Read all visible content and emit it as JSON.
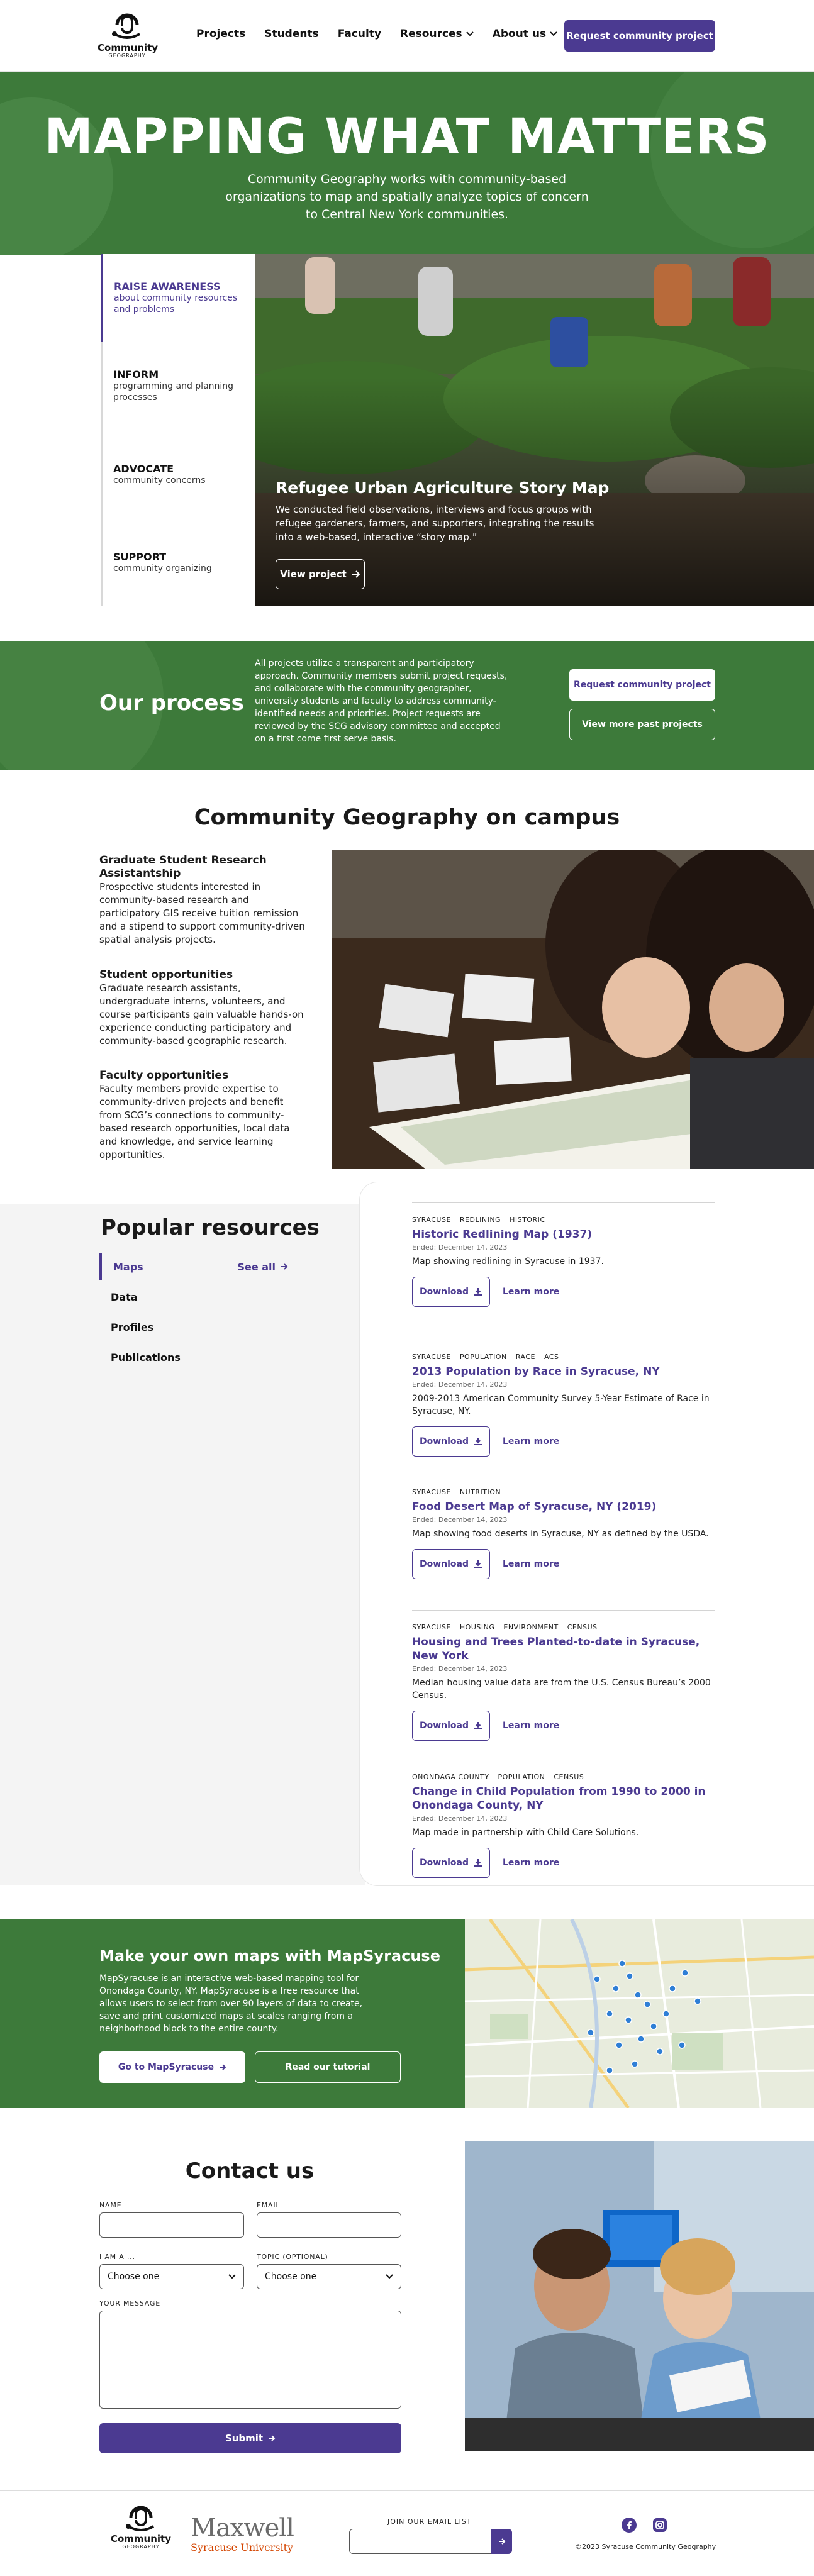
{
  "header": {
    "logo_line1": "Community",
    "logo_line2": "GEOGRAPHY",
    "nav": [
      "Projects",
      "Students",
      "Faculty",
      "Resources",
      "About us"
    ],
    "cta": "Request community project"
  },
  "hero": {
    "title": "MAPPING WHAT MATTERS",
    "subtitle": "Community Geography works with community-based organizations to map and spatially analyze topics of concern to Central New York communities."
  },
  "tabs": [
    {
      "title": "RAISE AWARENESS",
      "sub": "about community resources and problems"
    },
    {
      "title": "INFORM",
      "sub": "programming and planning processes"
    },
    {
      "title": "ADVOCATE",
      "sub": "community concerns"
    },
    {
      "title": "SUPPORT",
      "sub": "community organizing"
    }
  ],
  "feature": {
    "title": "Refugee Urban Agriculture Story Map",
    "desc": "We conducted field observations, interviews and focus groups with refugee gardeners, farmers, and supporters, integrating the results into a web-based, interactive “story map.”",
    "button": "View project"
  },
  "process": {
    "title": "Our process",
    "desc": "All projects utilize a transparent and participatory approach. Community members submit project requests, and collaborate with the community geographer, university students and faculty to address community-identified needs and priorities. Project requests are reviewed by the SCG advisory committee and accepted on a first come first serve basis.",
    "btn1": "Request community project",
    "btn2": "View more past projects"
  },
  "campus": {
    "title": "Community Geography on campus",
    "items": [
      {
        "title": "Graduate Student Research Assistantship",
        "desc": "Prospective students interested in community-based research and participatory GIS receive tuition remission and a stipend to support community-driven spatial analysis projects."
      },
      {
        "title": "Student opportunities",
        "desc": "Graduate research assistants, undergraduate interns, volunteers, and course participants gain valuable hands-on experience conducting participatory and community-based geographic research."
      },
      {
        "title": "Faculty opportunities",
        "desc": "Faculty members provide expertise to community-driven projects and benefit from SCG’s connections to community-based research opportunities, local data and knowledge, and service learning opportunities."
      }
    ]
  },
  "resources": {
    "title": "Popular resources",
    "nav": [
      "Maps",
      "Data",
      "Profiles",
      "Publications"
    ],
    "see_all": "See all",
    "download": "Download",
    "learn_more": "Learn more",
    "items": [
      {
        "tags": [
          "SYRACUSE",
          "REDLINING",
          "HISTORIC"
        ],
        "title": "Historic Redlining Map (1937)",
        "date": "Ended: December 14, 2023",
        "desc": "Map showing redlining in Syracuse in 1937."
      },
      {
        "tags": [
          "SYRACUSE",
          "POPULATION",
          "RACE",
          "ACS"
        ],
        "title": "2013 Population by Race in Syracuse, NY",
        "date": "Ended: December 14, 2023",
        "desc": "2009-2013 American Community Survey 5-Year Estimate of Race in Syracuse, NY."
      },
      {
        "tags": [
          "SYRACUSE",
          "NUTRITION"
        ],
        "title": "Food Desert Map of Syracuse, NY (2019)",
        "date": "Ended: December 14, 2023",
        "desc": "Map showing food deserts in Syracuse, NY as defined by the USDA."
      },
      {
        "tags": [
          "SYRACUSE",
          "HOUSING",
          "ENVIRONMENT",
          "CENSUS"
        ],
        "title": "Housing and Trees Planted-to-date in Syracuse, New York",
        "date": "Ended: December 14, 2023",
        "desc": "Median housing value data are from the U.S. Census Bureau’s 2000 Census."
      },
      {
        "tags": [
          "ONONDAGA COUNTY",
          "POPULATION",
          "CENSUS"
        ],
        "title": "Change in Child Population from 1990 to 2000 in Onondaga County, NY",
        "date": "Ended: December 14, 2023",
        "desc": "Map made in partnership with Child Care Solutions."
      }
    ]
  },
  "mapsyracuse": {
    "title": "Make your own maps with MapSyracuse",
    "desc": "MapSyracuse is an interactive web-based mapping tool for Onondaga County, NY. MapSyracuse is a free resource that allows users to select from over 90 layers of data to create, save and print customized maps at scales ranging from a neighborhood block to the entire county.",
    "btn1": "Go to MapSyracuse",
    "btn2": "Read our tutorial"
  },
  "contact": {
    "title": "Contact us",
    "name_label": "NAME",
    "email_label": "EMAIL",
    "iam_label": "I AM A ...",
    "topic_label": "TOPIC (OPTIONAL)",
    "iam_value": "Choose one",
    "topic_value": "Choose one",
    "message_label": "YOUR MESSAGE",
    "submit": "Submit"
  },
  "footer": {
    "maxwell": "Maxwell",
    "su": "Syracuse University",
    "email_label": "JOIN OUR EMAIL LIST",
    "copyright": "©2023 Syracuse Community Geography"
  },
  "colors": {
    "green": "#3d7a3a",
    "purple": "#4b3a91"
  }
}
